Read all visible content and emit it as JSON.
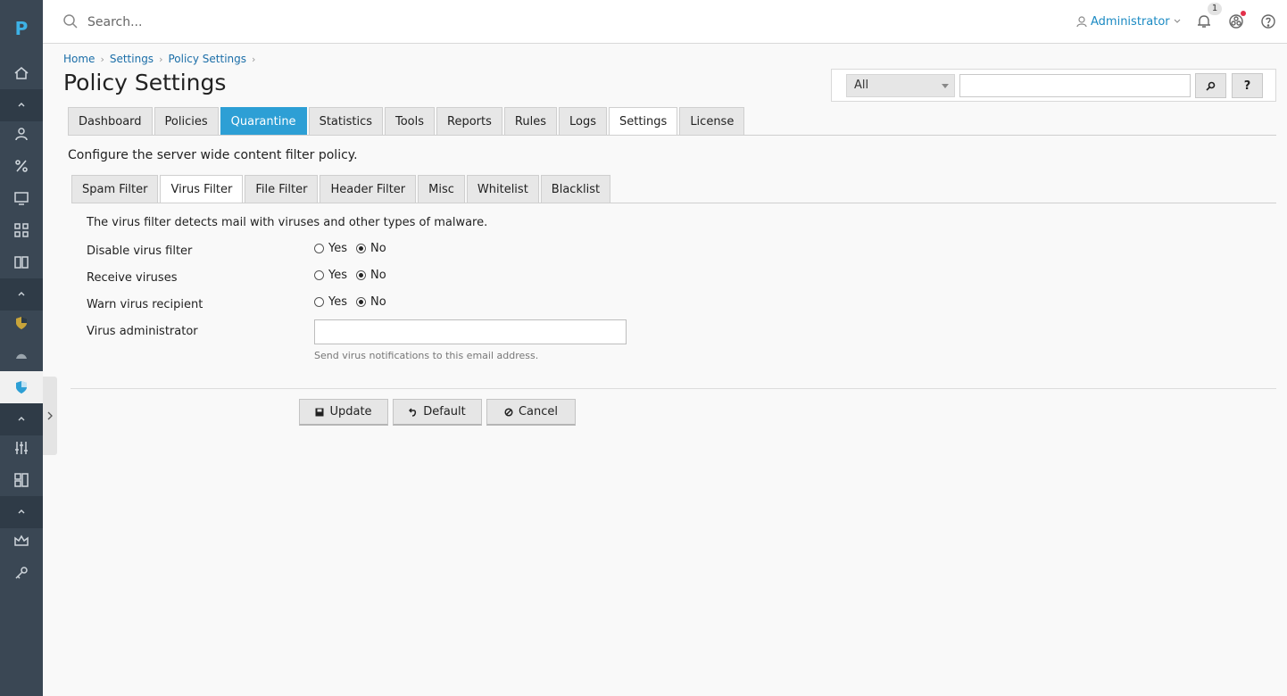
{
  "rail": {
    "logo": "P"
  },
  "topbar": {
    "search_placeholder": "Search...",
    "user_name": "Administrator",
    "notification_count": "1"
  },
  "breadcrumb": [
    "Home",
    "Settings",
    "Policy Settings"
  ],
  "page_title": "Policy Settings",
  "filter": {
    "selected": "All",
    "search_button": "⌕",
    "help_button": "?"
  },
  "main_tabs": [
    "Dashboard",
    "Policies",
    "Quarantine",
    "Statistics",
    "Tools",
    "Reports",
    "Rules",
    "Logs",
    "Settings",
    "License"
  ],
  "description": "Configure the server wide content filter policy.",
  "sub_tabs": [
    "Spam Filter",
    "Virus Filter",
    "File Filter",
    "Header Filter",
    "Misc",
    "Whitelist",
    "Blacklist"
  ],
  "virus_filter": {
    "intro": "The virus filter detects mail with viruses and other types of malware.",
    "yes_label": "Yes",
    "no_label": "No",
    "fields": [
      {
        "label": "Disable virus filter",
        "value": "No"
      },
      {
        "label": "Receive viruses",
        "value": "No"
      },
      {
        "label": "Warn virus recipient",
        "value": "No"
      }
    ],
    "admin_label": "Virus administrator",
    "admin_value": "",
    "admin_hint": "Send virus notifications to this email address."
  },
  "buttons": {
    "update": "Update",
    "default": "Default",
    "cancel": "Cancel"
  },
  "colors": {
    "rail_bg": "#3a4754",
    "accent": "#2d9fd5",
    "link": "#1b8ac3",
    "logo": "#3db2e6"
  }
}
